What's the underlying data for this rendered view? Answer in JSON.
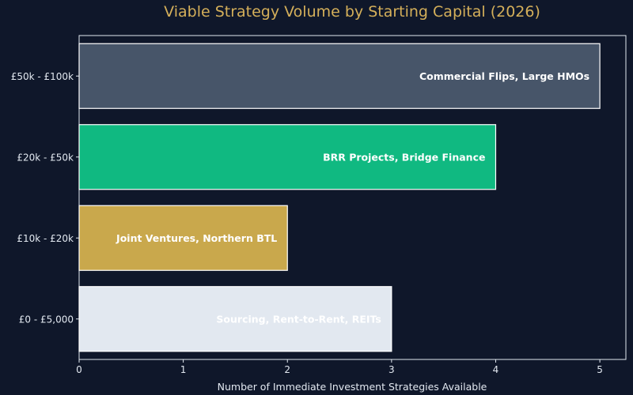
{
  "chart_data": {
    "type": "bar",
    "orientation": "horizontal",
    "title": "Viable Strategy Volume by Starting Capital (2026)",
    "xlabel": "Number of Immediate Investment Strategies Available",
    "ylabel": "",
    "xlim": [
      0,
      5.25
    ],
    "xticks": [
      "0",
      "1",
      "2",
      "3",
      "4",
      "5"
    ],
    "categories": [
      "£0 - £5,000",
      "£10k - £20k",
      "£20k - £50k",
      "£50k - £100k"
    ],
    "values": [
      3,
      2,
      4,
      5
    ],
    "bar_labels": [
      "Sourcing, Rent-to-Rent, REITs",
      "Joint Ventures, Northern BTL",
      "BRR Projects, Bridge Finance",
      "Commercial Flips, Large HMOs"
    ],
    "bar_colors": [
      "#e2e8f0",
      "#c9a84c",
      "#10b981",
      "#475569"
    ],
    "grid": false,
    "legend": "none"
  },
  "colors": {
    "background": "#0f172a",
    "title": "#d4af5a",
    "axis": "#e2e8f0",
    "label_text": "#ffffff"
  }
}
